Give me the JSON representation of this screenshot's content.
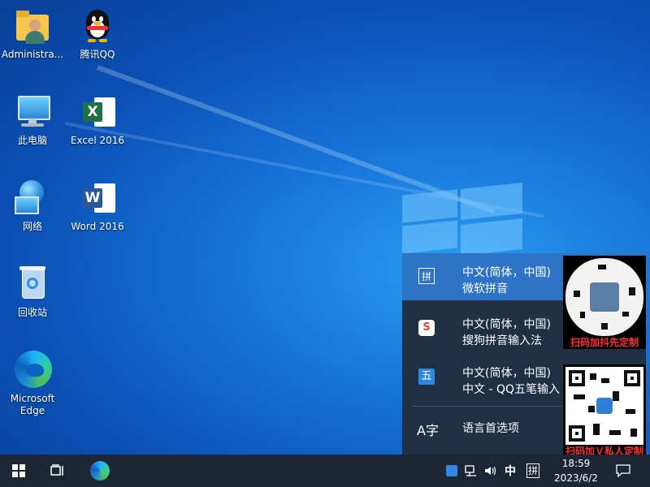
{
  "desktop": {
    "icons": [
      {
        "label": "Administra..."
      },
      {
        "label": "腾讯QQ"
      },
      {
        "label": "此电脑"
      },
      {
        "label": "Excel 2016"
      },
      {
        "label": "网络"
      },
      {
        "label": "Word 2016"
      },
      {
        "label": "回收站"
      },
      {
        "label": "Microsoft Edge"
      }
    ],
    "office_letters": {
      "excel": "X",
      "word": "W"
    }
  },
  "ime_menu": {
    "items": [
      {
        "icon_glyph": "拼",
        "line1": "中文(简体，中国)",
        "line2": "微软拼音",
        "active": true
      },
      {
        "icon_glyph": "S",
        "line1": "中文(简体，中国)",
        "line2": "搜狗拼音输入法",
        "active": false
      },
      {
        "icon_glyph": "五",
        "line1": "中文(简体，中国)",
        "line2": "中文 - QQ五笔输入",
        "active": false
      }
    ],
    "language_prefs": {
      "icon_glyph": "A字",
      "label": "语言首选项"
    }
  },
  "ads": {
    "top_caption": "扫码加抖先定制",
    "bottom_caption": "扫码加Ｖ私人定制"
  },
  "taskbar": {
    "tray": {
      "ime_mode": "中",
      "ime_indicator": "拼"
    },
    "clock": {
      "time": "18:59",
      "date": "2023/6/2"
    }
  },
  "colors": {
    "taskbar_bg": "#1c2634",
    "menu_bg": "#1f2f44",
    "menu_active": "#2d74c6",
    "ad_caption": "#ff3030"
  }
}
